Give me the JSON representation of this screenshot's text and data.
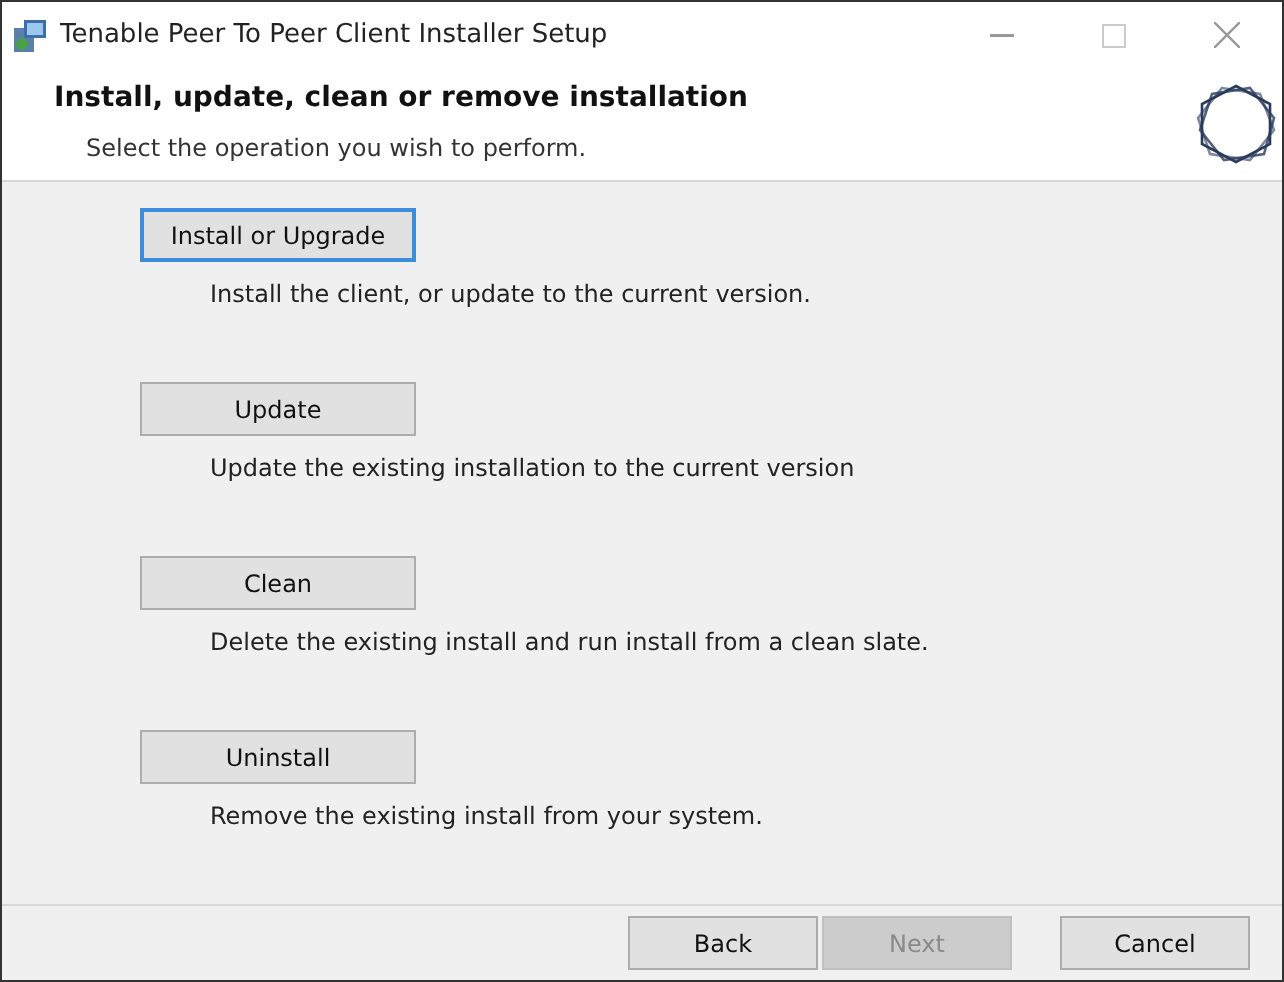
{
  "window": {
    "title": "Tenable Peer To Peer Client Installer Setup"
  },
  "header": {
    "title": "Install, update, clean or remove installation",
    "subtitle": "Select the operation you wish to perform."
  },
  "options": [
    {
      "label": "Install or Upgrade",
      "description": "Install the client, or update to the current version.",
      "focused": true
    },
    {
      "label": "Update",
      "description": "Update the existing installation to the current version",
      "focused": false
    },
    {
      "label": "Clean",
      "description": "Delete the existing install and run install from a clean slate.",
      "focused": false
    },
    {
      "label": "Uninstall",
      "description": "Remove the existing install from your system.",
      "focused": false
    }
  ],
  "footer_buttons": [
    {
      "label": "Back",
      "disabled": false
    },
    {
      "label": "Next",
      "disabled": true
    },
    {
      "label": "Cancel",
      "disabled": false
    }
  ]
}
